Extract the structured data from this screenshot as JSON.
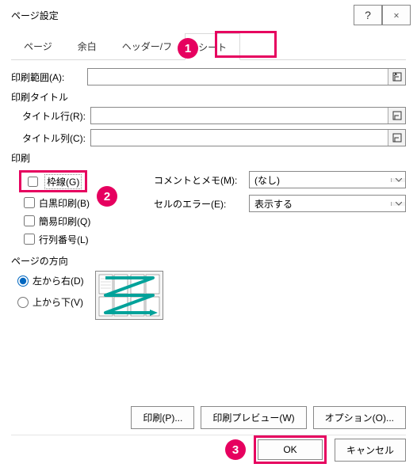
{
  "dialog": {
    "title": "ページ設定"
  },
  "tabs": {
    "page": "ページ",
    "margins": "余白",
    "headerfooter": "ヘッダー/フ",
    "sheet": "シート"
  },
  "labels": {
    "printArea": "印刷範囲(A):",
    "printTitles": "印刷タイトル",
    "titleRows": "タイトル行(R):",
    "titleCols": "タイトル列(C):",
    "printGroup": "印刷",
    "gridlines": "枠線(G)",
    "bw": "白黒印刷(B)",
    "draft": "簡易印刷(Q)",
    "rowcol": "行列番号(L)",
    "commentsLbl": "コメントとメモ(M):",
    "commentsVal": "(なし)",
    "errorsLbl": "セルのエラー(E):",
    "errorsVal": "表示する",
    "pageOrderGroup": "ページの方向",
    "downThenOver": "左から右(D)",
    "overThenDown": "上から下(V)"
  },
  "buttons": {
    "print": "印刷(P)...",
    "preview": "印刷プレビュー(W)",
    "options": "オプション(O)...",
    "ok": "OK",
    "cancel": "キャンセル"
  },
  "callouts": {
    "c1": "1",
    "c2": "2",
    "c3": "3"
  }
}
